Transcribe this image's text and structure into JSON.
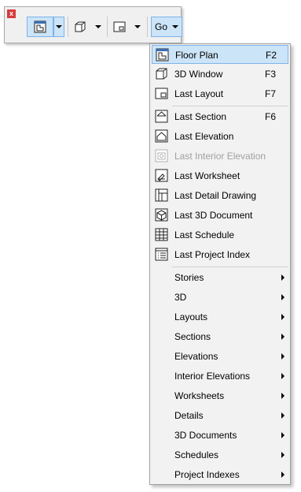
{
  "palette": {
    "close_label": "x",
    "go_label": "Go"
  },
  "menu": {
    "views": [
      {
        "label": "Floor Plan",
        "shortcut": "F2",
        "icon": "floor-plan-icon"
      },
      {
        "label": "3D Window",
        "shortcut": "F3",
        "icon": "3d-window-icon"
      },
      {
        "label": "Last Layout",
        "shortcut": "F7",
        "icon": "layout-icon"
      }
    ],
    "recent": [
      {
        "label": "Last Section",
        "shortcut": "F6",
        "icon": "section-icon"
      },
      {
        "label": "Last Elevation",
        "shortcut": "",
        "icon": "elevation-icon"
      },
      {
        "label": "Last Interior Elevation",
        "shortcut": "",
        "icon": "interior-elevation-icon",
        "disabled": true
      },
      {
        "label": "Last Worksheet",
        "shortcut": "",
        "icon": "worksheet-icon"
      },
      {
        "label": "Last Detail Drawing",
        "shortcut": "",
        "icon": "detail-drawing-icon"
      },
      {
        "label": "Last 3D Document",
        "shortcut": "",
        "icon": "3d-document-icon"
      },
      {
        "label": "Last Schedule",
        "shortcut": "",
        "icon": "schedule-icon"
      },
      {
        "label": "Last Project Index",
        "shortcut": "",
        "icon": "project-index-icon"
      }
    ],
    "submenus": [
      {
        "label": "Stories"
      },
      {
        "label": "3D"
      },
      {
        "label": "Layouts"
      },
      {
        "label": "Sections"
      },
      {
        "label": "Elevations"
      },
      {
        "label": "Interior Elevations"
      },
      {
        "label": "Worksheets"
      },
      {
        "label": "Details"
      },
      {
        "label": "3D Documents"
      },
      {
        "label": "Schedules"
      },
      {
        "label": "Project Indexes"
      }
    ]
  },
  "colors": {
    "selection_fill": "#cce4f7",
    "selection_border": "#7eb4ea",
    "menu_bg": "#f2f2f2",
    "disabled_text": "#a0a0a0"
  }
}
